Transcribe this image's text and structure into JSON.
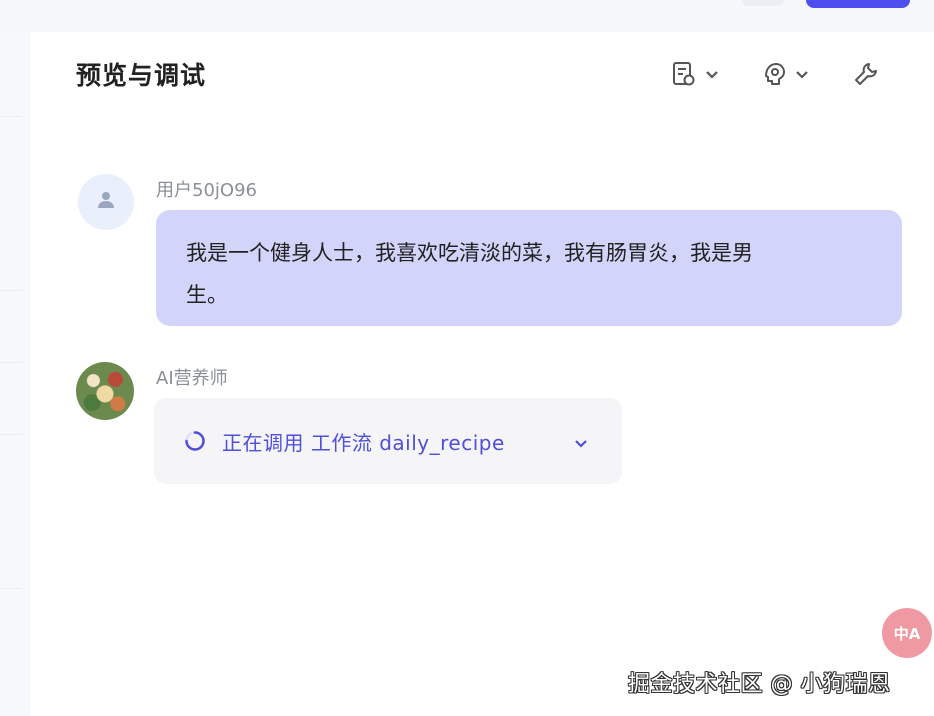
{
  "panel": {
    "title": "预览与调试",
    "toolbar": [
      {
        "icon": "document-settings-icon"
      },
      {
        "icon": "model-settings-icon"
      },
      {
        "icon": "wrench-icon"
      }
    ]
  },
  "messages": [
    {
      "role": "user",
      "sender": "用户50jO96",
      "text_line1": "我是一个健身人士，我喜欢吃清淡的菜，我有肠胃炎，我是男",
      "text_line2": "生。"
    },
    {
      "role": "assistant",
      "sender": "AI营养师",
      "status_text": "正在调用 工作流 daily_recipe"
    }
  ],
  "translate_button": {
    "label": "中A"
  },
  "watermark": "掘金技术社区 @ 小狗瑞恩",
  "colors": {
    "accent": "#4f4fd8",
    "user_bubble": "#d3d4fa",
    "assistant_bubble": "#f5f5f8"
  }
}
